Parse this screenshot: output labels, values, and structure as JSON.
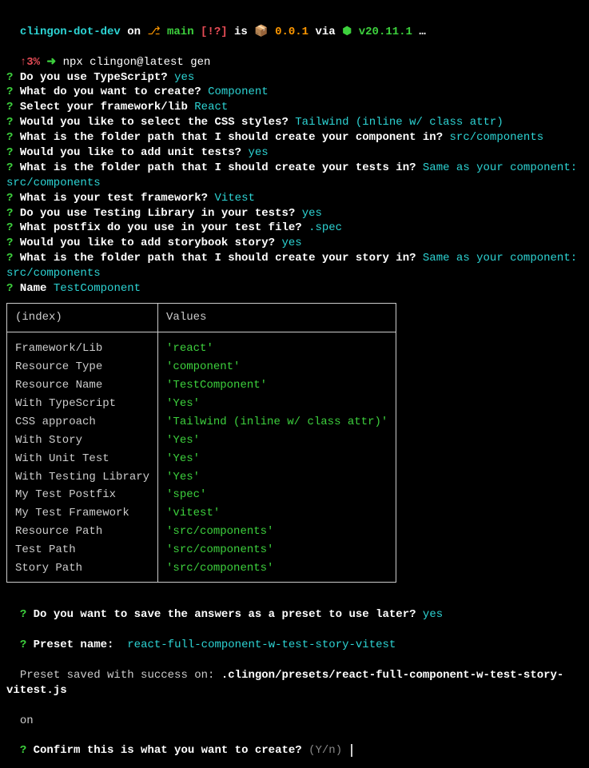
{
  "header": {
    "project": "clingon-dot-dev",
    "on": " on ",
    "branch_icon": "⎇",
    "branch": "main",
    "branch_status": "[!?]",
    "is": " is ",
    "pkg_icon": "📦",
    "version": "0.0.1",
    "via": " via ",
    "node_icon": "⬢ ",
    "node_version": "v20.11.1",
    "ellipsis": " …"
  },
  "prompt": {
    "battery_icon": "↑3%",
    "arrow": " ➜ ",
    "command": "npx clingon@latest gen"
  },
  "qm": "?",
  "q": [
    {
      "text": "Do you use TypeScript?",
      "answer": "yes"
    },
    {
      "text": "What do you want to create?",
      "answer": "Component"
    },
    {
      "text": "Select your framework/lib",
      "answer": "React"
    },
    {
      "text": "Would you like to select the CSS styles?",
      "answer": "Tailwind (inline w/ class attr)"
    },
    {
      "text": "What is the folder path that I should create your component in?",
      "answer": "src/components"
    },
    {
      "text": "Would you like to add unit tests?",
      "answer": "yes"
    },
    {
      "text": "What is the folder path that I should create your tests in?",
      "answer": "Same as your component: src/components"
    },
    {
      "text": "What is your test framework?",
      "answer": "Vitest"
    },
    {
      "text": "Do you use Testing Library in your tests?",
      "answer": "yes"
    },
    {
      "text": "What postfix do you use in your test file?",
      "answer": ".spec"
    },
    {
      "text": "Would you like to add storybook story?",
      "answer": "yes"
    },
    {
      "text": "What is the folder path that I should create your story in?",
      "answer": "Same as your component: src/components"
    },
    {
      "text": "Name",
      "answer": "TestComponent"
    }
  ],
  "table": {
    "headers": [
      "(index)",
      "Values"
    ],
    "rows": [
      {
        "key": "Framework/Lib",
        "val": "'react'"
      },
      {
        "key": "Resource Type",
        "val": "'component'"
      },
      {
        "key": "Resource Name",
        "val": "'TestComponent'"
      },
      {
        "key": "With TypeScript",
        "val": "'Yes'"
      },
      {
        "key": "CSS approach",
        "val": "'Tailwind (inline w/ class attr)'"
      },
      {
        "key": "With Story",
        "val": "'Yes'"
      },
      {
        "key": "With Unit Test",
        "val": "'Yes'"
      },
      {
        "key": "With Testing Library",
        "val": "'Yes'"
      },
      {
        "key": "My Test Postfix",
        "val": "'spec'"
      },
      {
        "key": "My Test Framework",
        "val": "'vitest'"
      },
      {
        "key": "Resource Path",
        "val": "'src/components'"
      },
      {
        "key": "Test Path",
        "val": "'src/components'"
      },
      {
        "key": "Story Path",
        "val": "'src/components'"
      }
    ]
  },
  "post": {
    "save_preset_q": "Do you want to save the answers as a preset to use later?",
    "save_preset_a": "yes",
    "preset_name_q": "Preset name:",
    "preset_name_a": " react-full-component-w-test-story-vitest",
    "saved_line1": "Preset saved with success on: ",
    "saved_path": ".clingon/presets/react-full-component-w-test-story-vitest.js",
    "saved_line2": "on",
    "confirm_q": "Confirm this is what you want to create?",
    "confirm_hint": " (Y/n) "
  }
}
